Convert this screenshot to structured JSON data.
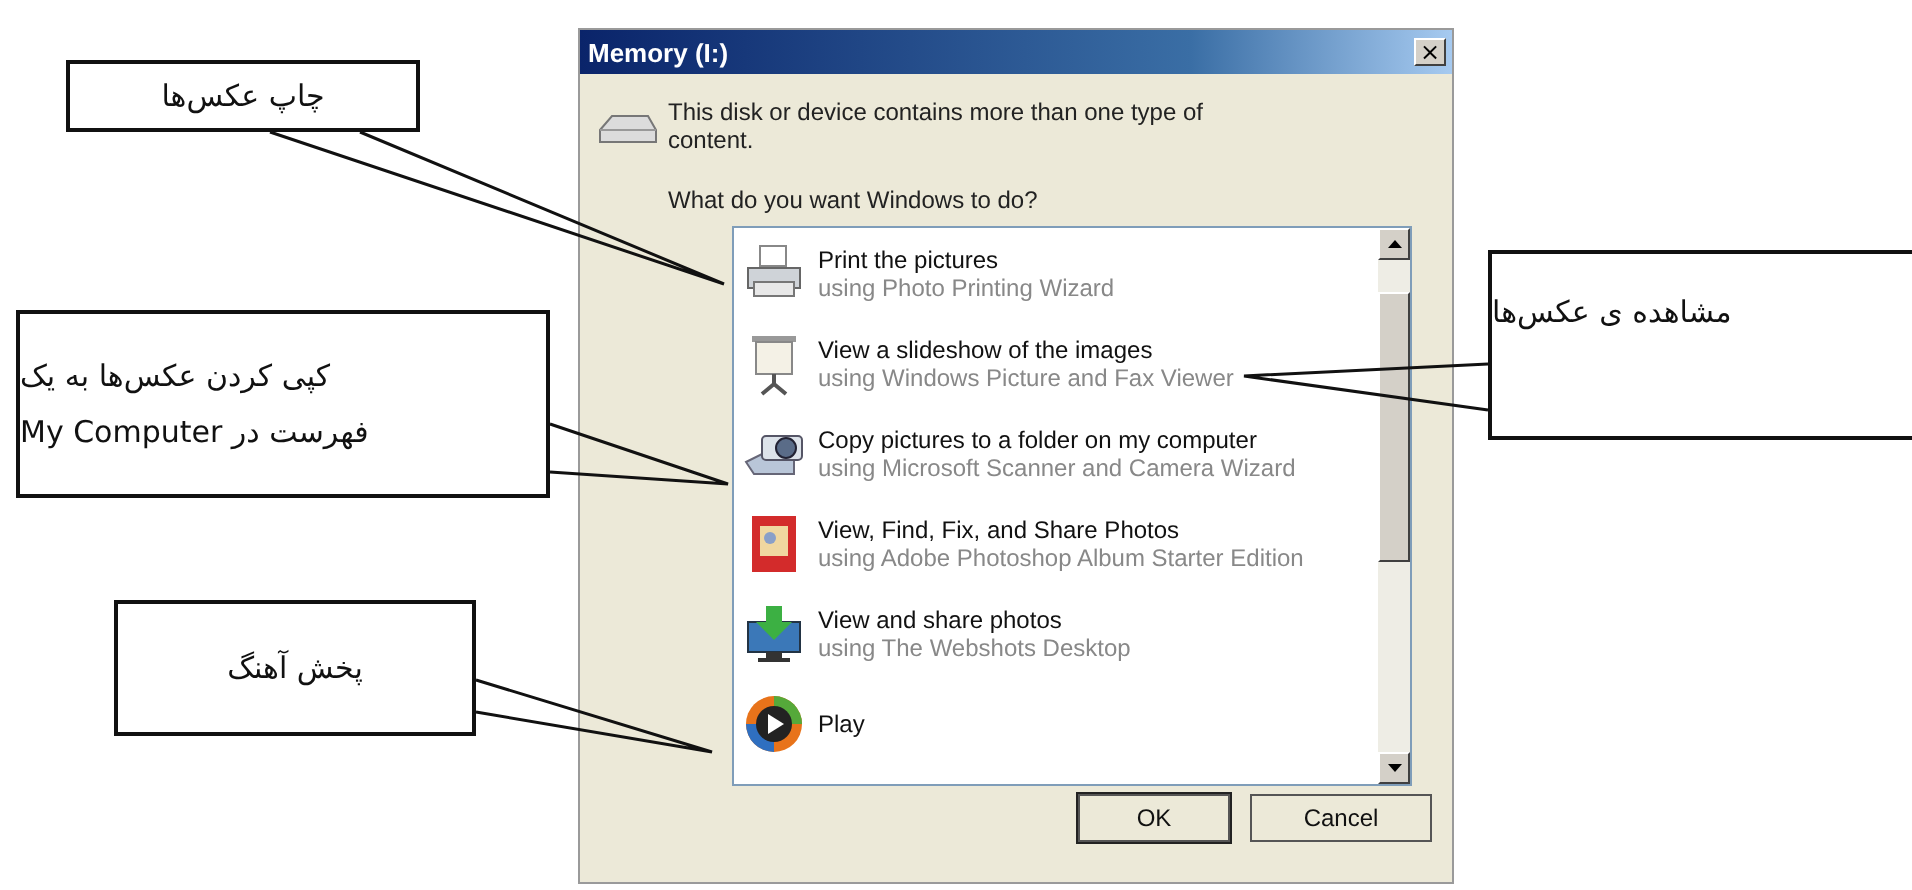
{
  "window": {
    "title": "Memory (I:)",
    "close": "×"
  },
  "message": "This disk or device contains more than one type of content.",
  "prompt": "What do you want Windows to do?",
  "actions": [
    {
      "kind": "printer",
      "title": "Print the pictures",
      "subtitle": "using Photo Printing Wizard"
    },
    {
      "kind": "projector",
      "title": "View a slideshow of the images",
      "subtitle": "using Windows Picture and Fax Viewer"
    },
    {
      "kind": "camera",
      "title": "Copy pictures to a folder on my computer",
      "subtitle": "using Microsoft Scanner and Camera Wizard"
    },
    {
      "kind": "album",
      "title": "View, Find, Fix, and Share Photos",
      "subtitle": "using Adobe Photoshop Album Starter Edition"
    },
    {
      "kind": "monitor",
      "title": "View and share photos",
      "subtitle": "using The Webshots Desktop"
    },
    {
      "kind": "player",
      "title": "Play"
    }
  ],
  "buttons": [
    "OK",
    "Cancel"
  ],
  "callouts": [
    {
      "lines": [
        "چاپ عکس‌ها"
      ]
    },
    {
      "lines": [
        "کپی کردن عکس‌ها به یک",
        "فهرست در My Computer"
      ]
    },
    {
      "lines": [
        "پخش آهنگ"
      ]
    },
    {
      "lines": [
        "مشاهده ی عکس‌ها"
      ]
    }
  ]
}
